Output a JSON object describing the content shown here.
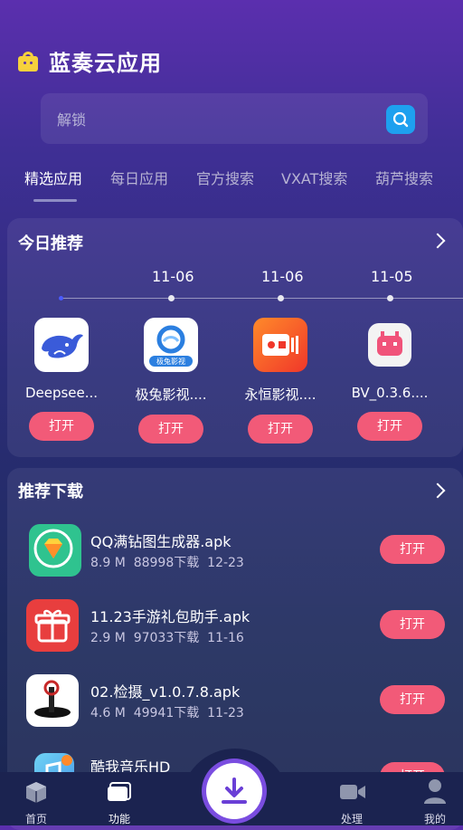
{
  "app": {
    "title": "蓝奏云应用"
  },
  "search": {
    "placeholder": "解锁"
  },
  "tabs": [
    "精选应用",
    "每日应用",
    "官方搜索",
    "VXAT搜索",
    "葫芦搜索"
  ],
  "today": {
    "title": "今日推荐",
    "dates": [
      "11-06",
      "11-06",
      "11-05"
    ],
    "items": [
      {
        "name": "Deepsee...",
        "button": "打开",
        "icon": "whale-icon",
        "color": "#2d55e6"
      },
      {
        "name": "极兔影视....",
        "button": "打开",
        "icon": "rabbit-video-icon",
        "color": "#2b7fe0",
        "icon_text": "极兔影视"
      },
      {
        "name": "永恒影视....",
        "button": "打开",
        "icon": "video-camera-icon",
        "color": "#f04a2c"
      },
      {
        "name": "BV_0.3.6....",
        "button": "打开",
        "icon": "pink-robot-icon",
        "color": "#f0537a"
      }
    ]
  },
  "downloads": {
    "title": "推荐下载",
    "items": [
      {
        "name": "QQ满钻图生成器.apk",
        "size": "8.9 M",
        "count": "88998下载",
        "date": "12-23",
        "button": "打开",
        "icon": "diamond-icon",
        "color": "#2fc38f"
      },
      {
        "name": "11.23手游礼包助手.apk",
        "size": "2.9 M",
        "count": "97033下载",
        "date": "11-16",
        "button": "打开",
        "icon": "gift-icon",
        "color": "#e83e3e"
      },
      {
        "name": "02.检摄_v1.0.7.8.apk",
        "size": "4.6 M",
        "count": "49941下载",
        "date": "11-23",
        "button": "打开",
        "icon": "camera-hole-icon",
        "color": "#ffffff"
      },
      {
        "name": "酷我音乐HD",
        "size": "",
        "count": "",
        "date": "",
        "button": "打开",
        "icon": "music-app-icon",
        "color": "#55b9f0"
      }
    ]
  },
  "nav": {
    "home": "首页",
    "features": "功能",
    "process": "处理",
    "mine": "我的"
  }
}
